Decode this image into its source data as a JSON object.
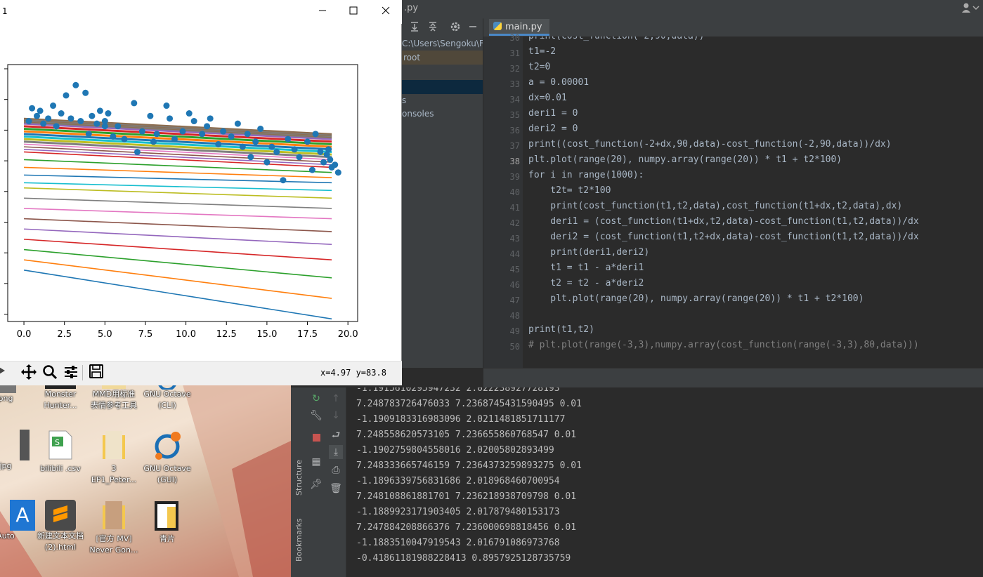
{
  "ide": {
    "title_fragment": ".py",
    "tab": "main.py",
    "project_path": "C:\\Users\\Sengoku\\F",
    "project_root": "root",
    "project_consoles": "onsoles",
    "project_item_s": "s",
    "lines": [
      {
        "n": "30",
        "t": "print(cost_function(-2,90,data))"
      },
      {
        "n": "31",
        "t": "t1=-2"
      },
      {
        "n": "32",
        "t": "t2=0"
      },
      {
        "n": "33",
        "t": "a = 0.00001"
      },
      {
        "n": "34",
        "t": "dx=0.01"
      },
      {
        "n": "35",
        "t": "deri1 = 0"
      },
      {
        "n": "36",
        "t": "deri2 = 0"
      },
      {
        "n": "37",
        "t": "print((cost_function(-2+dx,90,data)-cost_function(-2,90,data))/dx)"
      },
      {
        "n": "38",
        "t": "plt.plot(range(20), numpy.array(range(20)) * t1 + t2*100)"
      },
      {
        "n": "39",
        "t": "for i in range(1000):"
      },
      {
        "n": "40",
        "t": "    t2t= t2*100"
      },
      {
        "n": "41",
        "t": "    print(cost_function(t1,t2,data),cost_function(t1+dx,t2,data),dx)"
      },
      {
        "n": "42",
        "t": "    deri1 = (cost_function(t1+dx,t2,data)-cost_function(t1,t2,data))/dx"
      },
      {
        "n": "43",
        "t": "    deri2 = (cost_function(t1,t2+dx,data)-cost_function(t1,t2,data))/dx"
      },
      {
        "n": "44",
        "t": "    print(deri1,deri2)"
      },
      {
        "n": "45",
        "t": "    t1 = t1 - a*deri1"
      },
      {
        "n": "46",
        "t": "    t2 = t2 - a*deri2"
      },
      {
        "n": "47",
        "t": "    plt.plot(range(20), numpy.array(range(20)) * t1 + t2*100)"
      },
      {
        "n": "48",
        "t": ""
      },
      {
        "n": "49",
        "t": "print(t1,t2)"
      },
      {
        "n": "50",
        "t": "# plt.plot(range(-3,3),numpy.array(cost_function(range(-3,3),80,data)))"
      }
    ]
  },
  "console": {
    "lines": [
      "-1.1915610295947232 2.022238927728193",
      "7.248783726476033 7.2368745431590495 0.01",
      "-1.1909183316983096 2.0211481851711177",
      "7.248558620573105 7.236655860768547 0.01",
      "-1.1902759804558016 2.02005802893499",
      "7.248333665746159 7.2364373259893275 0.01",
      "-1.1896339756831686 2.018968460700954",
      "7.248108861881701 7.236218938709798 0.01",
      "-1.1889923171903405 2.017879480153173",
      "7.247884208866376 7.236000698818456 0.01",
      "-1.1883510047919543 2.016791086973768",
      "-0.41861181988228413 0.8957925128735759"
    ],
    "side_structure": "Structure",
    "side_bookmarks": "Bookmarks"
  },
  "desktop": {
    "icons": [
      {
        "label1": "png",
        "label2": ""
      },
      {
        "label1": "Monster",
        "label2": "Hunter..."
      },
      {
        "label1": "MMD用标准",
        "label2": "表情参考工具"
      },
      {
        "label1": "GNU Octave",
        "label2": "(CLI)"
      },
      {
        "label1": "jpg",
        "label2": ""
      },
      {
        "label1": "bilibili .csv",
        "label2": ""
      },
      {
        "label1": "3",
        "label2": "EP1_Peter..."
      },
      {
        "label1": "GNU Octave",
        "label2": "(GUI)"
      },
      {
        "label1": "Auto",
        "label2": ""
      },
      {
        "label1": "新建文本文档",
        "label2": "(2).html"
      },
      {
        "label1": "[官方 MV]",
        "label2": "Never Gon..."
      },
      {
        "label1": "青片",
        "label2": ""
      }
    ]
  },
  "figure": {
    "window_title": "1",
    "coords": "x=4.97 y=83.8",
    "colors": {
      "scatter": "#1f77b4"
    },
    "palette": [
      "#1f77b4",
      "#ff7f0e",
      "#2ca02c",
      "#d62728",
      "#9467bd",
      "#8c564b",
      "#e377c2",
      "#7f7f7f",
      "#bcbd22",
      "#17becf"
    ]
  },
  "chart_data": {
    "type": "scatter",
    "x_ticks": [
      "0.0",
      "2.5",
      "5.0",
      "7.5",
      "10.0",
      "12.5",
      "15.0",
      "17.5",
      "20.0"
    ],
    "xlim": [
      -1,
      20.6
    ],
    "ylim": [
      0,
      100
    ],
    "lines": {
      "x": [
        0,
        19
      ],
      "y_start": [
        20,
        24,
        28,
        32,
        36,
        40,
        44,
        48,
        52,
        54,
        57,
        60,
        63,
        66,
        67,
        68,
        69,
        70,
        71,
        72,
        73,
        74,
        75,
        76,
        77
      ],
      "y_end": [
        1,
        9,
        17,
        24,
        30,
        35,
        40,
        44,
        48,
        51,
        54,
        56,
        58,
        60,
        61,
        62,
        63,
        64,
        65,
        66,
        67,
        68,
        69,
        70,
        71
      ]
    },
    "points": {
      "x": [
        0.3,
        0.5,
        0.8,
        1.0,
        1.2,
        1.5,
        1.8,
        2.0,
        2.3,
        2.6,
        2.9,
        3.2,
        3.5,
        3.8,
        4.0,
        4.2,
        4.5,
        4.7,
        5.0,
        5.0,
        5.2,
        5.5,
        5.8,
        6.2,
        6.8,
        7.0,
        7.3,
        7.8,
        8.0,
        8.2,
        8.8,
        9.0,
        9.3,
        9.8,
        10.2,
        10.5,
        11.0,
        11.3,
        11.5,
        12.0,
        12.3,
        12.8,
        13.2,
        13.5,
        13.8,
        14.0,
        14.3,
        14.6,
        15.0,
        15.3,
        15.6,
        16.0,
        16.3,
        16.7,
        17.0,
        17.5,
        17.8,
        18.0,
        18.3,
        18.5,
        18.8,
        19.0,
        19.2,
        19.4,
        18.7,
        18.9
      ],
      "y": [
        78,
        83,
        80,
        82,
        77,
        79,
        84,
        76,
        81,
        88,
        79,
        92,
        78,
        89,
        73,
        80,
        77,
        82,
        76,
        78,
        81,
        72,
        76,
        71,
        85,
        66,
        74,
        80,
        70,
        73,
        84,
        79,
        71,
        74,
        81,
        78,
        73,
        76,
        79,
        69,
        74,
        72,
        77,
        68,
        73,
        64,
        70,
        75,
        62,
        68,
        66,
        55,
        71,
        67,
        64,
        70,
        59,
        73,
        66,
        62,
        67,
        60,
        61,
        58,
        65,
        63
      ]
    }
  }
}
